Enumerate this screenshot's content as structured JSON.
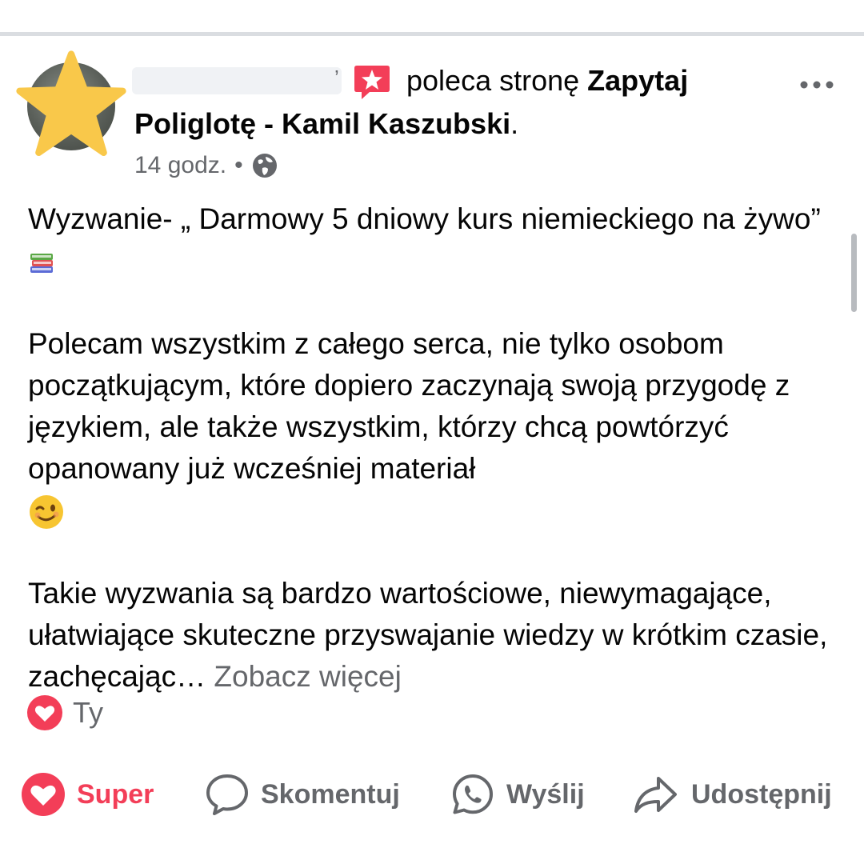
{
  "post": {
    "author_suffix": "’",
    "header_text": "poleca stronę",
    "page_name_part1": "Zapytaj",
    "page_name_part2": "Poliglotę - Kamil Kaszubski",
    "header_end": ".",
    "time": "14 godz.",
    "separator": "•",
    "paragraph1": "Wyzwanie- „ Darmowy 5 dniowy kurs niemieckiego na żywo”",
    "paragraph2": "Polecam wszystkim z całego serca, nie tylko osobom początkującym, które dopiero zaczynają swoją przygodę z językiem, ale także wszystkim, którzy chcą powtórzyć opanowany już wcześniej materiał",
    "paragraph3": "Takie wyzwania są bardzo wartościowe, niewymagające, ułatwiające skuteczne przyswajanie wiedzy w krótkim czasie, zachęcając…",
    "see_more": "Zobacz więcej"
  },
  "reactions": {
    "icon": "heart-reaction-icon",
    "who": "Ty"
  },
  "actions": {
    "super": "Super",
    "comment": "Skomentuj",
    "send": "Wyślij",
    "share": "Udostępnij"
  },
  "colors": {
    "reaction_red": "#f33e58",
    "secondary_text": "#65676b",
    "divider": "#dadde1",
    "star_overlay": "#f9c84a"
  }
}
